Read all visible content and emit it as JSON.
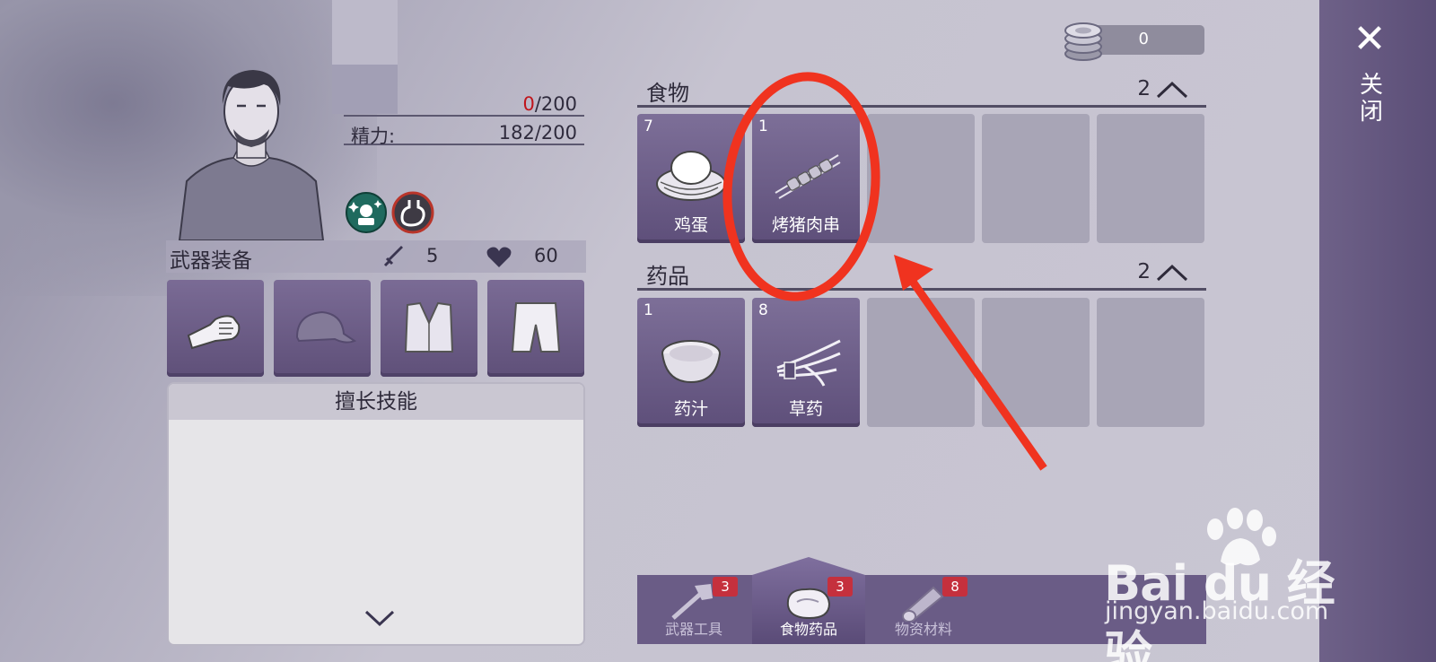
{
  "header": {
    "coins": "0",
    "close_label": "关闭"
  },
  "character": {
    "stats": [
      {
        "label": "",
        "current": "0",
        "max": "/200"
      },
      {
        "label": "精力:",
        "current": "182",
        "max": "/200"
      }
    ],
    "status_icons": [
      "sparkle-person-icon",
      "stomach-icon"
    ]
  },
  "equipment": {
    "title": "武器装备",
    "attack": "5",
    "health": "60",
    "slots": [
      "fist-icon",
      "cap-icon",
      "vest-icon",
      "shorts-icon"
    ]
  },
  "skills": {
    "title": "擅长技能"
  },
  "inventory": {
    "categories": [
      {
        "title": "食物",
        "count": "2",
        "items": [
          {
            "count": "7",
            "name": "鸡蛋",
            "icon": "egg-nest-icon"
          },
          {
            "count": "1",
            "name": "烤猪肉串",
            "icon": "skewer-icon"
          }
        ]
      },
      {
        "title": "药品",
        "count": "2",
        "items": [
          {
            "count": "1",
            "name": "药汁",
            "icon": "bowl-icon"
          },
          {
            "count": "8",
            "name": "草药",
            "icon": "herb-icon"
          }
        ]
      }
    ]
  },
  "tabs": [
    {
      "label": "武器工具",
      "badge": "3",
      "icon": "axe-icon"
    },
    {
      "label": "食物药品",
      "badge": "3",
      "icon": "meat-icon",
      "active": true
    },
    {
      "label": "物资材料",
      "badge": "8",
      "icon": "log-icon"
    }
  ],
  "watermark": {
    "brand": "Bai du 经验",
    "url": "jingyan.baidu.com"
  },
  "colors": {
    "slot_filled": "#6c5d88",
    "slot_empty": "#a8a5b6",
    "badge": "#c5303d",
    "annotation": "#f0331f"
  }
}
